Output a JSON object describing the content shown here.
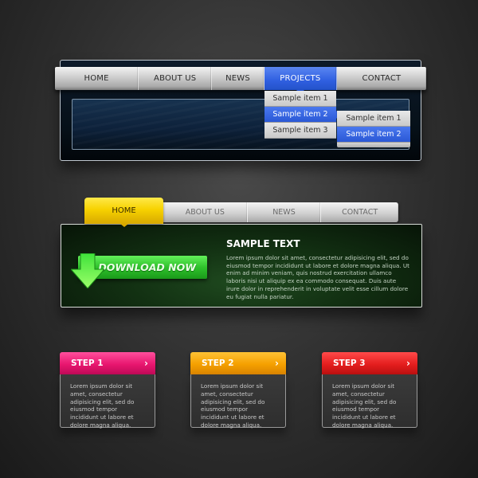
{
  "section1": {
    "nav": [
      "HOME",
      "ABOUT US",
      "NEWS",
      "PROJECTS",
      "CONTACT"
    ],
    "active_index": 3,
    "dropdown": [
      "Sample item 1",
      "Sample item 2",
      "Sample item 3"
    ],
    "dropdown_selected": 1,
    "submenu": [
      "Sample item 1",
      "Sample item 2"
    ],
    "submenu_selected": 1
  },
  "section2": {
    "home": "HOME",
    "nav": [
      "ABOUT US",
      "NEWS",
      "CONTACT"
    ],
    "download_label": "DOWNLOAD NOW",
    "title": "SAMPLE TEXT",
    "body": "Lorem ipsum dolor sit amet, consectetur adipisicing elit, sed do eiusmod tempor incididunt ut labore et dolore magna aliqua. Ut enim ad minim veniam, quis nostrud exercitation ullamco laboris nisi ut aliquip ex ea commodo consequat. Duis aute irure dolor in reprehenderit in voluptate velit esse cillum dolore eu fugiat nulla pariatur."
  },
  "steps": [
    {
      "title": "STEP 1",
      "chevron": "›",
      "body": "Lorem ipsum dolor sit amet, consectetur adipisicing elit, sed do eiusmod tempor incididunt ut labore et dolore magna aliqua.",
      "color": "#e8166f"
    },
    {
      "title": "STEP 2",
      "chevron": "›",
      "body": "Lorem ipsum dolor sit amet, consectetur adipisicing elit, sed do eiusmod tempor incididunt ut labore et dolore magna aliqua.",
      "color": "#f5a000"
    },
    {
      "title": "STEP 3",
      "chevron": "›",
      "body": "Lorem ipsum dolor sit amet, consectetur adipisicing elit, sed do eiusmod tempor incididunt ut labore et dolore magna aliqua.",
      "color": "#e41e1e"
    }
  ]
}
